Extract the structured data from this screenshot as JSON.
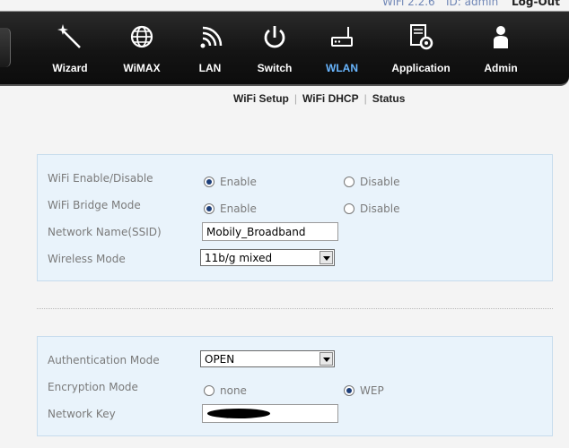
{
  "header": {
    "version": "WiFi 2.2.6",
    "user": "ID: admin",
    "logout_label": "Log-Out"
  },
  "nav": {
    "items": [
      {
        "label": "Wizard",
        "icon": "magic-wand-icon"
      },
      {
        "label": "WiMAX",
        "icon": "globe-icon"
      },
      {
        "label": "LAN",
        "icon": "signal-arcs-icon"
      },
      {
        "label": "Switch",
        "icon": "power-icon"
      },
      {
        "label": "WLAN",
        "icon": "router-icon"
      },
      {
        "label": "Application",
        "icon": "gear-app-icon"
      },
      {
        "label": "Admin",
        "icon": "user-icon"
      }
    ],
    "active": "WLAN",
    "active_color": "#69b6ff"
  },
  "subnav": {
    "items": [
      "WiFi Setup",
      "WiFi DHCP",
      "Status"
    ]
  },
  "basic": {
    "wifi_enable": {
      "label": "WiFi Enable/Disable",
      "opt1": "Enable",
      "opt2": "Disable",
      "selected": "Enable"
    },
    "bridge_mode": {
      "label": "WiFi Bridge Mode",
      "opt1": "Enable",
      "opt2": "Disable",
      "selected": "Enable"
    },
    "ssid": {
      "label": "Network Name(SSID)",
      "value": "Mobily_Broadband"
    },
    "wireless_mode": {
      "label": "Wireless Mode",
      "value": "11b/g mixed"
    }
  },
  "security": {
    "auth_mode": {
      "label": "Authentication Mode",
      "value": "OPEN"
    },
    "encryption": {
      "label": "Encryption Mode",
      "opt1": "none",
      "opt2": "WEP",
      "selected": "WEP"
    },
    "network_key": {
      "label": "Network Key"
    }
  }
}
